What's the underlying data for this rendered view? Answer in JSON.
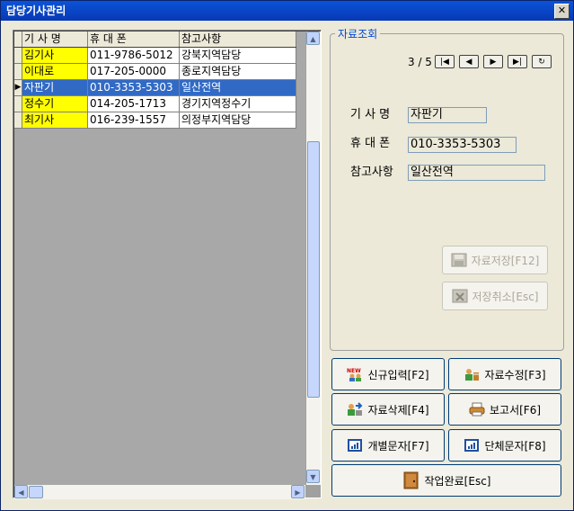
{
  "window": {
    "title": "담당기사관리"
  },
  "grid": {
    "columns": [
      "기 사 명",
      "휴 대 폰",
      "참고사항"
    ],
    "rows": [
      {
        "name": "김기사",
        "phone": "011-9786-5012",
        "note": "강북지역담당"
      },
      {
        "name": "이대로",
        "phone": "017-205-0000",
        "note": "종로지역담당"
      },
      {
        "name": "자판기",
        "phone": "010-3353-5303",
        "note": "일산전역"
      },
      {
        "name": "정수기",
        "phone": "014-205-1713",
        "note": "경기지역정수기"
      },
      {
        "name": "최기사",
        "phone": "016-239-1557",
        "note": "의정부지역담당"
      }
    ],
    "selected_index": 2
  },
  "detail": {
    "group_title": "자료조회",
    "record_position": "3 / 5",
    "labels": {
      "name": "기 사 명",
      "phone": "휴 대 폰",
      "note": "참고사항"
    },
    "values": {
      "name": "자판기",
      "phone": "010-3353-5303",
      "note": "일산전역"
    },
    "save_label": "자료저장[F12]",
    "cancel_label": "저장취소[Esc]"
  },
  "actions": {
    "new": "신규입력[F2]",
    "edit": "자료수정[F3]",
    "delete": "자료삭제[F4]",
    "report": "보고서[F6]",
    "sms_single": "개별문자[F7]",
    "sms_group": "단체문자[F8]",
    "done": "작업완료[Esc]",
    "new_icon_text": "NEW"
  }
}
